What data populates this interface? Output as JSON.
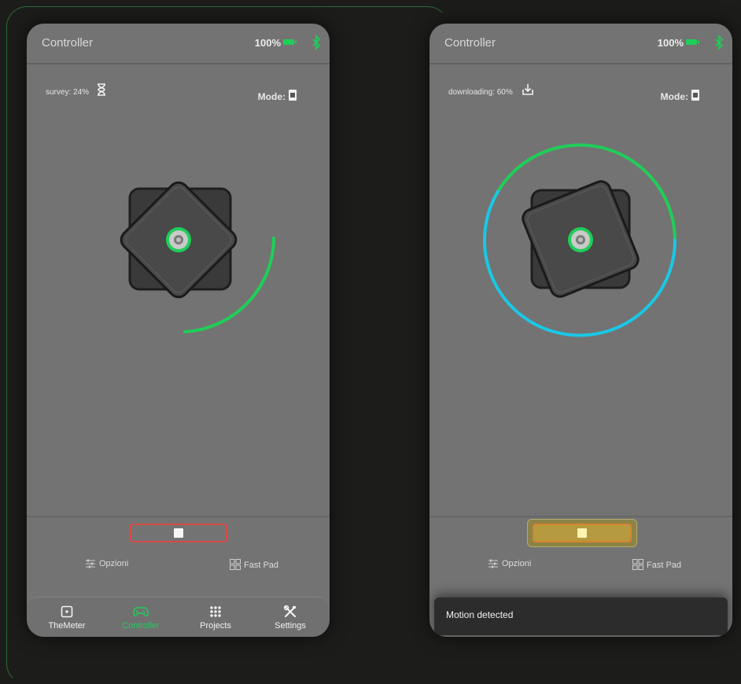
{
  "screens": [
    {
      "app_title": "Controller",
      "battery": "100%",
      "status_text": "survey: 24%",
      "status_icon": "hourglass-icon",
      "mode_label": "Mode:",
      "progress_green_pct": 24,
      "options_label": "Opzioni",
      "fastpad_label": "Fast Pad",
      "nav": [
        {
          "label": "TheMeter",
          "icon": "meter-icon"
        },
        {
          "label": "Controller",
          "icon": "gamepad-icon"
        },
        {
          "label": "Projects",
          "icon": "grid-dots-icon"
        },
        {
          "label": "Settings",
          "icon": "tools-icon"
        }
      ]
    },
    {
      "app_title": "Controller",
      "battery": "100%",
      "status_text": "downloading: 60%",
      "status_icon": "download-icon",
      "mode_label": "Mode:",
      "progress_green_pct": 24,
      "progress_blue_pct": 60,
      "options_label": "Opzioni",
      "fastpad_label": "Fast Pad",
      "snackbar_text": "Motion detected"
    }
  ],
  "colors": {
    "accent_green": "#1fce58",
    "progress_blue": "#1ac8e6",
    "stop_red": "#d84b45",
    "stop_amber": "#d8842c"
  }
}
